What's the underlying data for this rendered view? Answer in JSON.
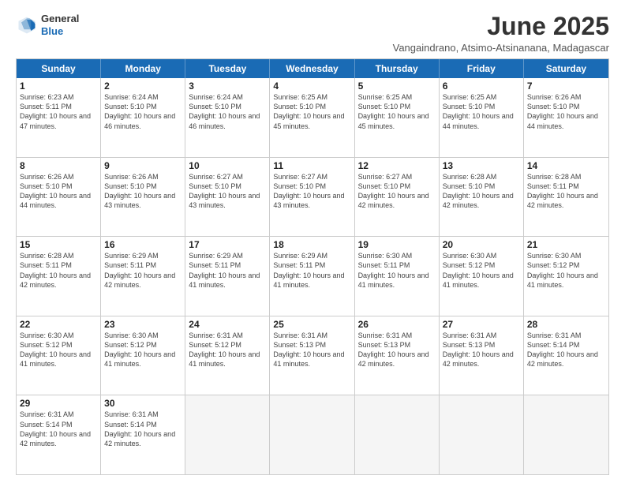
{
  "logo": {
    "general": "General",
    "blue": "Blue"
  },
  "title": "June 2025",
  "subtitle": "Vangaindrano, Atsimo-Atsinanana, Madagascar",
  "header": {
    "days": [
      "Sunday",
      "Monday",
      "Tuesday",
      "Wednesday",
      "Thursday",
      "Friday",
      "Saturday"
    ]
  },
  "weeks": [
    {
      "cells": [
        {
          "day": "1",
          "sunrise": "6:23 AM",
          "sunset": "5:11 PM",
          "daylight": "10 hours and 47 minutes."
        },
        {
          "day": "2",
          "sunrise": "6:24 AM",
          "sunset": "5:10 PM",
          "daylight": "10 hours and 46 minutes."
        },
        {
          "day": "3",
          "sunrise": "6:24 AM",
          "sunset": "5:10 PM",
          "daylight": "10 hours and 46 minutes."
        },
        {
          "day": "4",
          "sunrise": "6:25 AM",
          "sunset": "5:10 PM",
          "daylight": "10 hours and 45 minutes."
        },
        {
          "day": "5",
          "sunrise": "6:25 AM",
          "sunset": "5:10 PM",
          "daylight": "10 hours and 45 minutes."
        },
        {
          "day": "6",
          "sunrise": "6:25 AM",
          "sunset": "5:10 PM",
          "daylight": "10 hours and 44 minutes."
        },
        {
          "day": "7",
          "sunrise": "6:26 AM",
          "sunset": "5:10 PM",
          "daylight": "10 hours and 44 minutes."
        }
      ]
    },
    {
      "cells": [
        {
          "day": "8",
          "sunrise": "6:26 AM",
          "sunset": "5:10 PM",
          "daylight": "10 hours and 44 minutes."
        },
        {
          "day": "9",
          "sunrise": "6:26 AM",
          "sunset": "5:10 PM",
          "daylight": "10 hours and 43 minutes."
        },
        {
          "day": "10",
          "sunrise": "6:27 AM",
          "sunset": "5:10 PM",
          "daylight": "10 hours and 43 minutes."
        },
        {
          "day": "11",
          "sunrise": "6:27 AM",
          "sunset": "5:10 PM",
          "daylight": "10 hours and 43 minutes."
        },
        {
          "day": "12",
          "sunrise": "6:27 AM",
          "sunset": "5:10 PM",
          "daylight": "10 hours and 42 minutes."
        },
        {
          "day": "13",
          "sunrise": "6:28 AM",
          "sunset": "5:10 PM",
          "daylight": "10 hours and 42 minutes."
        },
        {
          "day": "14",
          "sunrise": "6:28 AM",
          "sunset": "5:11 PM",
          "daylight": "10 hours and 42 minutes."
        }
      ]
    },
    {
      "cells": [
        {
          "day": "15",
          "sunrise": "6:28 AM",
          "sunset": "5:11 PM",
          "daylight": "10 hours and 42 minutes."
        },
        {
          "day": "16",
          "sunrise": "6:29 AM",
          "sunset": "5:11 PM",
          "daylight": "10 hours and 42 minutes."
        },
        {
          "day": "17",
          "sunrise": "6:29 AM",
          "sunset": "5:11 PM",
          "daylight": "10 hours and 41 minutes."
        },
        {
          "day": "18",
          "sunrise": "6:29 AM",
          "sunset": "5:11 PM",
          "daylight": "10 hours and 41 minutes."
        },
        {
          "day": "19",
          "sunrise": "6:30 AM",
          "sunset": "5:11 PM",
          "daylight": "10 hours and 41 minutes."
        },
        {
          "day": "20",
          "sunrise": "6:30 AM",
          "sunset": "5:12 PM",
          "daylight": "10 hours and 41 minutes."
        },
        {
          "day": "21",
          "sunrise": "6:30 AM",
          "sunset": "5:12 PM",
          "daylight": "10 hours and 41 minutes."
        }
      ]
    },
    {
      "cells": [
        {
          "day": "22",
          "sunrise": "6:30 AM",
          "sunset": "5:12 PM",
          "daylight": "10 hours and 41 minutes."
        },
        {
          "day": "23",
          "sunrise": "6:30 AM",
          "sunset": "5:12 PM",
          "daylight": "10 hours and 41 minutes."
        },
        {
          "day": "24",
          "sunrise": "6:31 AM",
          "sunset": "5:12 PM",
          "daylight": "10 hours and 41 minutes."
        },
        {
          "day": "25",
          "sunrise": "6:31 AM",
          "sunset": "5:13 PM",
          "daylight": "10 hours and 41 minutes."
        },
        {
          "day": "26",
          "sunrise": "6:31 AM",
          "sunset": "5:13 PM",
          "daylight": "10 hours and 42 minutes."
        },
        {
          "day": "27",
          "sunrise": "6:31 AM",
          "sunset": "5:13 PM",
          "daylight": "10 hours and 42 minutes."
        },
        {
          "day": "28",
          "sunrise": "6:31 AM",
          "sunset": "5:14 PM",
          "daylight": "10 hours and 42 minutes."
        }
      ]
    },
    {
      "cells": [
        {
          "day": "29",
          "sunrise": "6:31 AM",
          "sunset": "5:14 PM",
          "daylight": "10 hours and 42 minutes."
        },
        {
          "day": "30",
          "sunrise": "6:31 AM",
          "sunset": "5:14 PM",
          "daylight": "10 hours and 42 minutes."
        },
        {
          "day": "",
          "empty": true
        },
        {
          "day": "",
          "empty": true
        },
        {
          "day": "",
          "empty": true
        },
        {
          "day": "",
          "empty": true
        },
        {
          "day": "",
          "empty": true
        }
      ]
    }
  ]
}
